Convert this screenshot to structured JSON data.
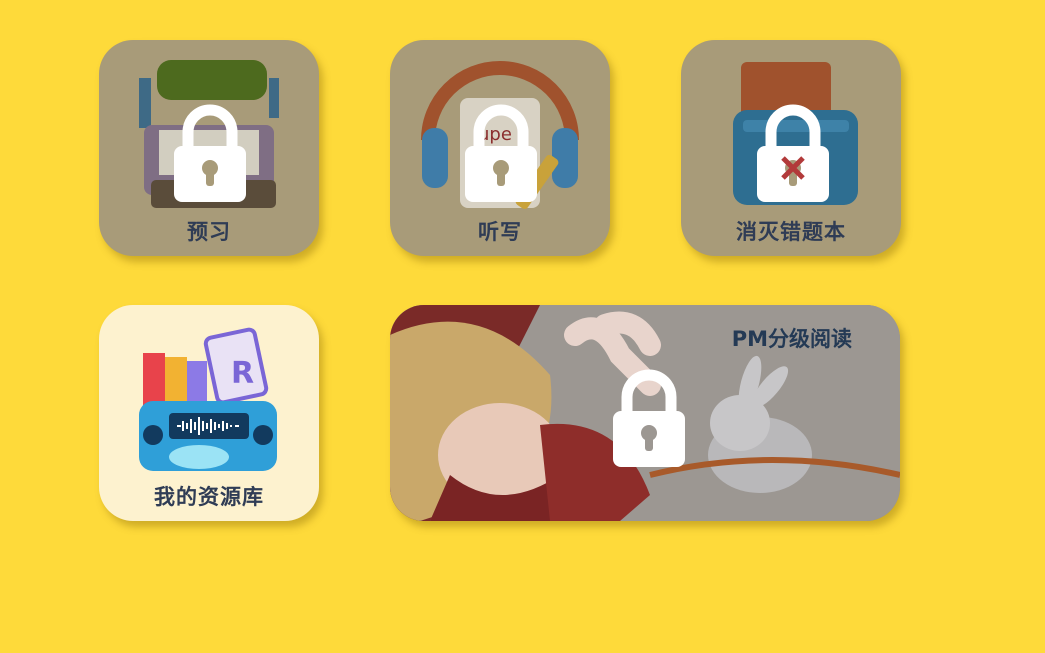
{
  "background_color": "#FEDA3A",
  "tiles": [
    {
      "label": "预习",
      "locked": true,
      "icon": "book-lamp-icon"
    },
    {
      "label": "听写",
      "locked": true,
      "icon": "headphones-notebook-icon"
    },
    {
      "label": "消灭错题本",
      "locked": true,
      "icon": "folder-box-icon"
    },
    {
      "label": "我的资源库",
      "locked": false,
      "icon": "radio-books-icon"
    }
  ],
  "banner": {
    "label": "PM分级阅读",
    "locked": true,
    "image": "girl-rabbit-reading-illustration"
  },
  "colors": {
    "lock": "#FFFFFF",
    "locked_overlay": "#A89B79",
    "unlocked_tile": "#FDF2CF",
    "label": "#2F3C55"
  }
}
